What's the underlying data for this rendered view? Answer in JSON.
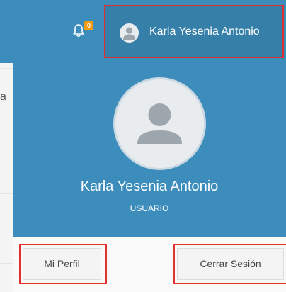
{
  "navbar": {
    "notifications": {
      "icon": "bell-icon",
      "count": "0",
      "badge_color": "#f39c12"
    },
    "user_menu": {
      "name": "Karla Yesenia Antonio",
      "icon": "user-avatar-icon"
    }
  },
  "page_fragment": "a",
  "dropdown": {
    "header": {
      "name": "Karla Yesenia Antonio",
      "role": "USUARIO"
    },
    "footer": {
      "profile_label": "Mi Perfil",
      "logout_label": "Cerrar Sesión"
    }
  },
  "colors": {
    "header_bg": "#3c8dbc",
    "highlight": "#e0312e"
  }
}
